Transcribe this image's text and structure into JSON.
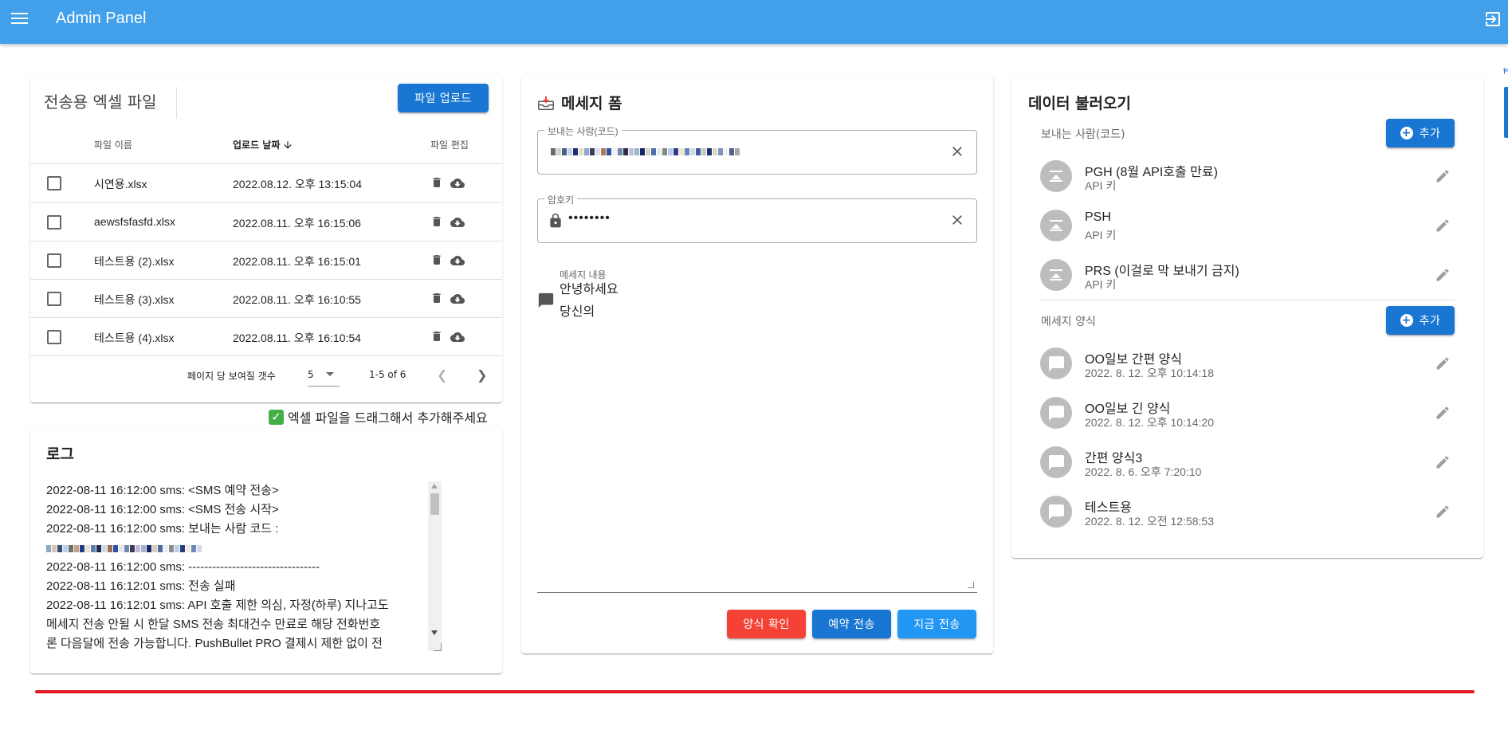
{
  "appbar": {
    "title": "Admin Panel"
  },
  "colors": {
    "appbar": "#42a0ea",
    "primary": "#1976d2",
    "light": "#2196f3",
    "danger": "#f44336",
    "redline": "#e31b23"
  },
  "file_card": {
    "title": "전송용 엑셀 파일",
    "upload_label": "파일 업로드",
    "headers": {
      "name": "파일 이름",
      "date": "업로드 날짜",
      "edit": "파일 편집"
    },
    "rows": [
      {
        "name": "시연용.xlsx",
        "date": "2022.08.12. 오후 13:15:04"
      },
      {
        "name": "aewsfsfasfd.xlsx",
        "date": "2022.08.11. 오후 16:15:06"
      },
      {
        "name": "테스트용 (2).xlsx",
        "date": "2022.08.11. 오후 16:15:01"
      },
      {
        "name": "테스트용 (3).xlsx",
        "date": "2022.08.11. 오후 16:10:55"
      },
      {
        "name": "테스트용 (4).xlsx",
        "date": "2022.08.11. 오후 16:10:54"
      }
    ],
    "pager": {
      "per_page_label": "페이지 당 보여질 갯수",
      "per_page": "5",
      "range": "1-5 of 6"
    }
  },
  "drag_hint": "엑셀 파일을 드래그해서 추가해주세요",
  "log_card": {
    "title": "로그",
    "lines": [
      "2022-08-11 16:12:00 sms: <SMS 예약 전송>",
      "2022-08-11 16:12:00 sms: <SMS 전송 시작>",
      "2022-08-11 16:12:00 sms: 보내는 사람 코드 :",
      "",
      "2022-08-11 16:12:00 sms: ---------------------------------",
      "2022-08-11 16:12:01 sms:                        전송 실패",
      "2022-08-11 16:12:01 sms: API 호출 제한 의심, 자정(하루) 지나고도",
      "메세지 전송 안될 시 한달 SMS 전송 최대건수 만료로 해당 전화번호",
      "론 다음달에 전송 가능합니다. PushBullet PRO 결제시 제한 없이 전"
    ]
  },
  "message_form": {
    "title": "메세지 폼",
    "sender_label": "보내는 사람(코드)",
    "password_label": "암호키",
    "password_value": "••••••••",
    "content_label": "메세지 내용",
    "content_value": "안녕하세요\n당신의",
    "buttons": {
      "check": "양식 확인",
      "reserve": "예약 전송",
      "now": "지금 전송"
    }
  },
  "data_card": {
    "title": "데이터 불러오기",
    "senders_label": "보내는 사람(코드)",
    "add_label": "추가",
    "senders": [
      {
        "name": "PGH (8월 API호출 만료)",
        "sub": "API 키"
      },
      {
        "name": "PSH",
        "sub": "API 키"
      },
      {
        "name": "PRS (이걸로 막 보내기 금지)",
        "sub": "API 키"
      }
    ],
    "templates_label": "메세지 양식",
    "templates": [
      {
        "name": "OO일보 간편 양식",
        "sub": "2022. 8. 12. 오후 10:14:18"
      },
      {
        "name": "OO일보 긴 양식",
        "sub": "2022. 8. 12. 오후 10:14:20"
      },
      {
        "name": "간편 양식3",
        "sub": "2022. 8. 6. 오후 7:20:10"
      },
      {
        "name": "테스트용",
        "sub": "2022. 8. 12. 오전 12:58:53"
      }
    ]
  }
}
